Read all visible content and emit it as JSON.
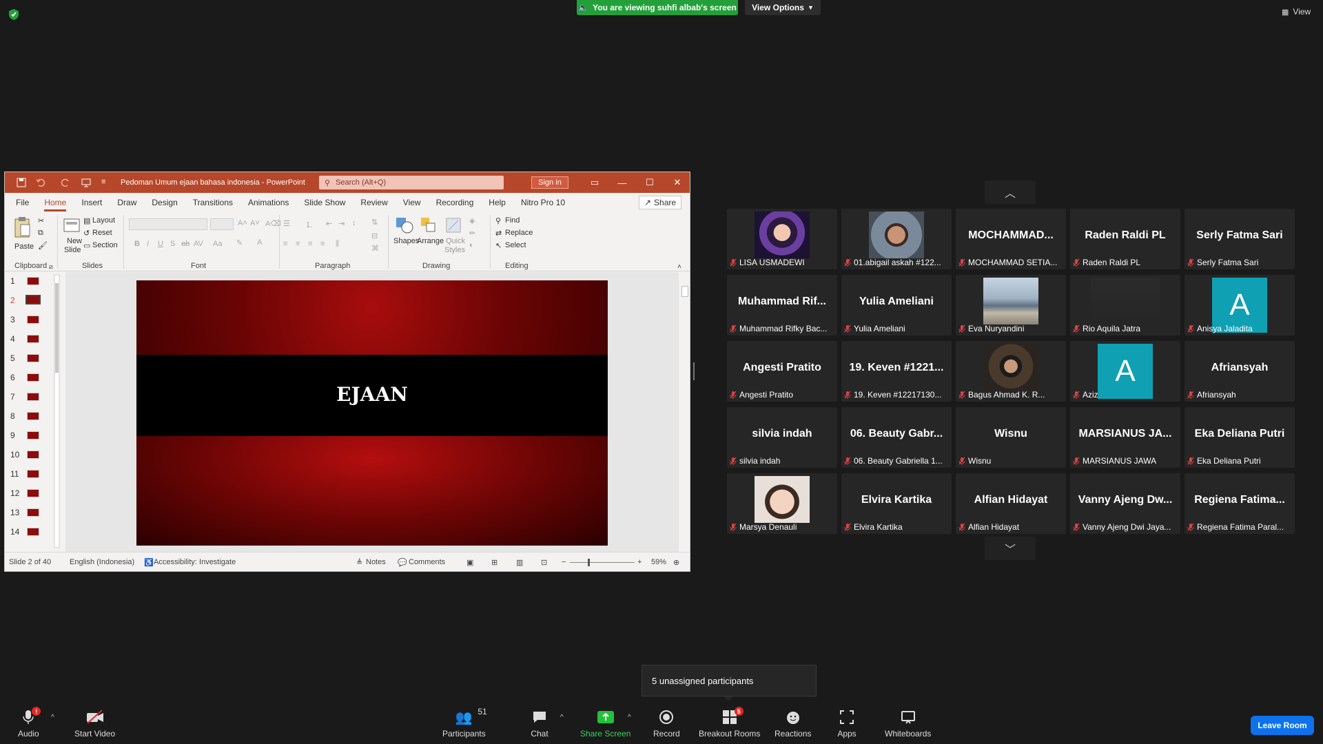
{
  "banner": {
    "text": "You are viewing suhfi albab's screen",
    "view_options": "View Options",
    "view_button": "View"
  },
  "ppt": {
    "doc_title": "Pedoman Umum ejaan bahasa indonesia - PowerPoint",
    "search_placeholder": "Search (Alt+Q)",
    "sign_in": "Sign in",
    "share": "Share",
    "tabs": [
      "File",
      "Home",
      "Insert",
      "Draw",
      "Design",
      "Transitions",
      "Animations",
      "Slide Show",
      "Review",
      "View",
      "Recording",
      "Help",
      "Nitro Pro 10"
    ],
    "ribbon": {
      "clipboard": {
        "label": "Clipboard",
        "paste": "Paste"
      },
      "slides": {
        "label": "Slides",
        "new_slide": "New",
        "new_slide2": "Slide",
        "layout": "Layout",
        "reset": "Reset",
        "section": "Section"
      },
      "font": {
        "label": "Font"
      },
      "paragraph": {
        "label": "Paragraph"
      },
      "drawing": {
        "label": "Drawing",
        "shapes": "Shapes",
        "arrange": "Arrange",
        "quick": "Quick",
        "styles": "Styles"
      },
      "editing": {
        "label": "Editing",
        "find": "Find",
        "replace": "Replace",
        "select": "Select"
      }
    },
    "thumbnails": [
      "1",
      "2",
      "3",
      "4",
      "5",
      "6",
      "7",
      "8",
      "9",
      "10",
      "11",
      "12",
      "13",
      "14"
    ],
    "slide_title": "EJAAN",
    "status": {
      "slide": "Slide 2 of 40",
      "language": "English (Indonesia)",
      "accessibility": "Accessibility: Investigate",
      "notes": "Notes",
      "comments": "Comments",
      "zoom": "59%"
    }
  },
  "gallery": [
    {
      "big": "",
      "name": "LISA USMADEWI",
      "photo": "woman-selfie"
    },
    {
      "big": "",
      "name": "01.abigail askah #122...",
      "photo": "man-glasses"
    },
    {
      "big": "MOCHAMMAD...",
      "name": "MOCHAMMAD SETIA..."
    },
    {
      "big": "Raden Raldi PL",
      "name": "Raden Raldi PL"
    },
    {
      "big": "Serly Fatma Sari",
      "name": "Serly Fatma Sari"
    },
    {
      "big": "Muhammad Rif...",
      "name": "Muhammad Rifky Bac..."
    },
    {
      "big": "Yulia Ameliani",
      "name": "Yulia Ameliani"
    },
    {
      "big": "",
      "name": "Eva Nuryandini",
      "photo": "beach"
    },
    {
      "big": "",
      "name": "Rio Aquila Jatra",
      "photo": "dark"
    },
    {
      "big": "",
      "name": "Anisya Jaladita",
      "avatar": "A"
    },
    {
      "big": "Angesti Pratito",
      "name": "Angesti Pratito"
    },
    {
      "big": "19. Keven #1221...",
      "name": "19. Keven #12217130..."
    },
    {
      "big": "",
      "name": "Bagus Ahmad K. R...",
      "photo": "man-portrait"
    },
    {
      "big": "",
      "name": "Aziz",
      "avatar": "A"
    },
    {
      "big": "Afriansyah",
      "name": "Afriansyah"
    },
    {
      "big": "silvia indah",
      "name": "silvia indah"
    },
    {
      "big": "06. Beauty Gabr...",
      "name": "06. Beauty Gabriella 1..."
    },
    {
      "big": "Wisnu",
      "name": "Wisnu"
    },
    {
      "big": "MARSIANUS JA...",
      "name": "MARSIANUS JAWA"
    },
    {
      "big": "Eka Deliana Putri",
      "name": "Eka Deliana Putri"
    },
    {
      "big": "",
      "name": "Marsya Denauli",
      "photo": "woman-closeup"
    },
    {
      "big": "Elvira Kartika",
      "name": "Elvira Kartika"
    },
    {
      "big": "Alfian Hidayat",
      "name": "Alfian Hidayat"
    },
    {
      "big": "Vanny Ajeng Dw...",
      "name": "Vanny Ajeng Dwi Jaya..."
    },
    {
      "big": "Regiena Fatima...",
      "name": "Regiena Fatima Paral..."
    }
  ],
  "unassigned": "5 unassigned participants",
  "toolbar": {
    "audio": "Audio",
    "audio_badge": "!",
    "video": "Start Video",
    "participants": "Participants",
    "participants_count": "51",
    "chat": "Chat",
    "share_screen": "Share Screen",
    "record": "Record",
    "breakout": "Breakout Rooms",
    "breakout_badge": "5",
    "reactions": "Reactions",
    "apps": "Apps",
    "whiteboards": "Whiteboards",
    "leave": "Leave Room"
  },
  "colors": {
    "accent_green": "#23a03a",
    "ppt_red": "#b7472a",
    "zoom_blue": "#0e72ed",
    "avatar_teal": "#0fa0b3"
  }
}
